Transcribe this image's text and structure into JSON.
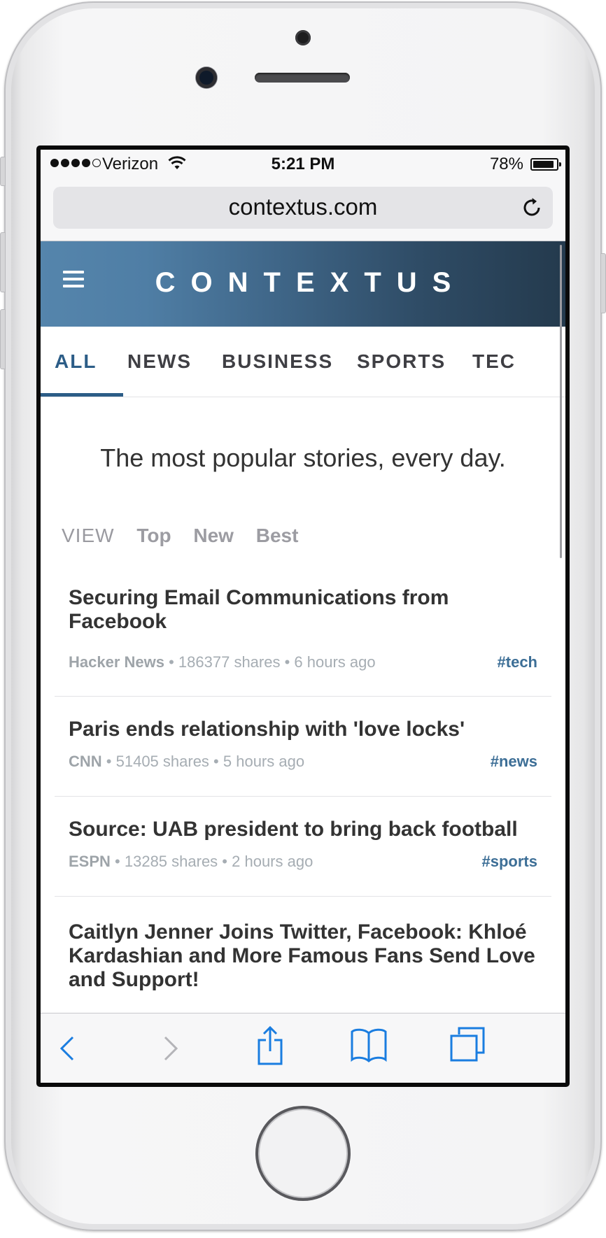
{
  "status_bar": {
    "carrier": "Verizon",
    "time": "5:21 PM",
    "battery": "78%",
    "battery_level": 0.78
  },
  "browser": {
    "url": "contextus.com"
  },
  "site": {
    "logo": "CONTEXTUS",
    "tabs": [
      "ALL",
      "NEWS",
      "BUSINESS",
      "SPORTS",
      "TEC"
    ],
    "active_tab": "ALL",
    "tagline": "The most popular stories, every day.",
    "view": {
      "label": "VIEW",
      "options": [
        "Top",
        "New",
        "Best"
      ]
    }
  },
  "stories": [
    {
      "title": "Securing Email Communications from Facebook",
      "source": "Hacker News",
      "shares": "186377 shares",
      "age": "6 hours ago",
      "tag": "#tech"
    },
    {
      "title": "Paris ends relationship with 'love locks'",
      "source": "CNN",
      "shares": "51405 shares",
      "age": "5 hours ago",
      "tag": "#news"
    },
    {
      "title": "Source: UAB president to bring back football",
      "source": "ESPN",
      "shares": "13285 shares",
      "age": "2 hours ago",
      "tag": "#sports"
    },
    {
      "title": "Caitlyn Jenner Joins Twitter, Facebook: Khloé Kardashian and More Famous Fans Send Love and Support!"
    }
  ],
  "colors": {
    "accent": "#2c5d87",
    "tag": "#3c6e96",
    "ios_blue": "#1a7de0",
    "header_left": "#5585ac",
    "header_right": "#243a4d"
  },
  "toolbar_icons": [
    "back-icon",
    "forward-icon",
    "share-icon",
    "bookmarks-icon",
    "tabs-icon"
  ]
}
